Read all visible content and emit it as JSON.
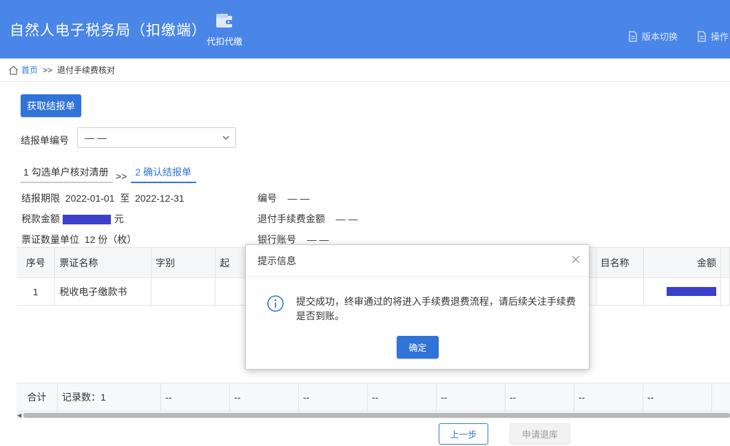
{
  "header": {
    "app_title": "自然人电子税务局（扣缴端）",
    "nav_label": "代扣代缴",
    "version_switch": "版本切换",
    "operation": "操作"
  },
  "breadcrumb": {
    "home": "首页",
    "separator": ">>",
    "current": "退付手续费核对"
  },
  "toolbar": {
    "get_report_button": "获取结报单"
  },
  "report_number": {
    "label": "结报单编号",
    "value": "— —"
  },
  "steps": [
    {
      "label": "1 勾选单户核对清册"
    },
    {
      "label": "2 确认结报单"
    }
  ],
  "step_separator": ">>",
  "details": {
    "period_label": "结报期限",
    "period_start": "2022-01-01",
    "period_to": "至",
    "period_end": "2022-12-31",
    "tax_amount_label": "税款金额",
    "tax_amount_unit": "元",
    "voucher_label": "票证数量单位",
    "voucher_value": "12 份（枚）",
    "number_label": "编号",
    "number_value": "— —",
    "refund_fee_label": "退付手续费金额",
    "refund_fee_value": "— —",
    "bank_account_label": "银行账号",
    "bank_account_value": "— —"
  },
  "table": {
    "columns": [
      "序号",
      "票证名称",
      "字别",
      "起",
      "目名称",
      "金额"
    ],
    "rows": [
      {
        "seq": "1",
        "name": "税收电子缴款书",
        "zi": "",
        "qi": ""
      }
    ],
    "total": {
      "label": "合计",
      "count": "记录数：1",
      "dashes": [
        "--",
        "--",
        "--",
        "--",
        "--",
        "--",
        "--",
        "--"
      ]
    }
  },
  "footer": {
    "prev_button": "上一步",
    "apply_button": "申请退库"
  },
  "dialog": {
    "title": "提示信息",
    "message": "提交成功，终审通过的将进入手续费退费流程，请后续关注手续费是否到账。",
    "ok_button": "确定"
  },
  "colors": {
    "header_bg": "#4a86e8",
    "primary": "#2f74d6",
    "mask": "#3b3fc9"
  }
}
